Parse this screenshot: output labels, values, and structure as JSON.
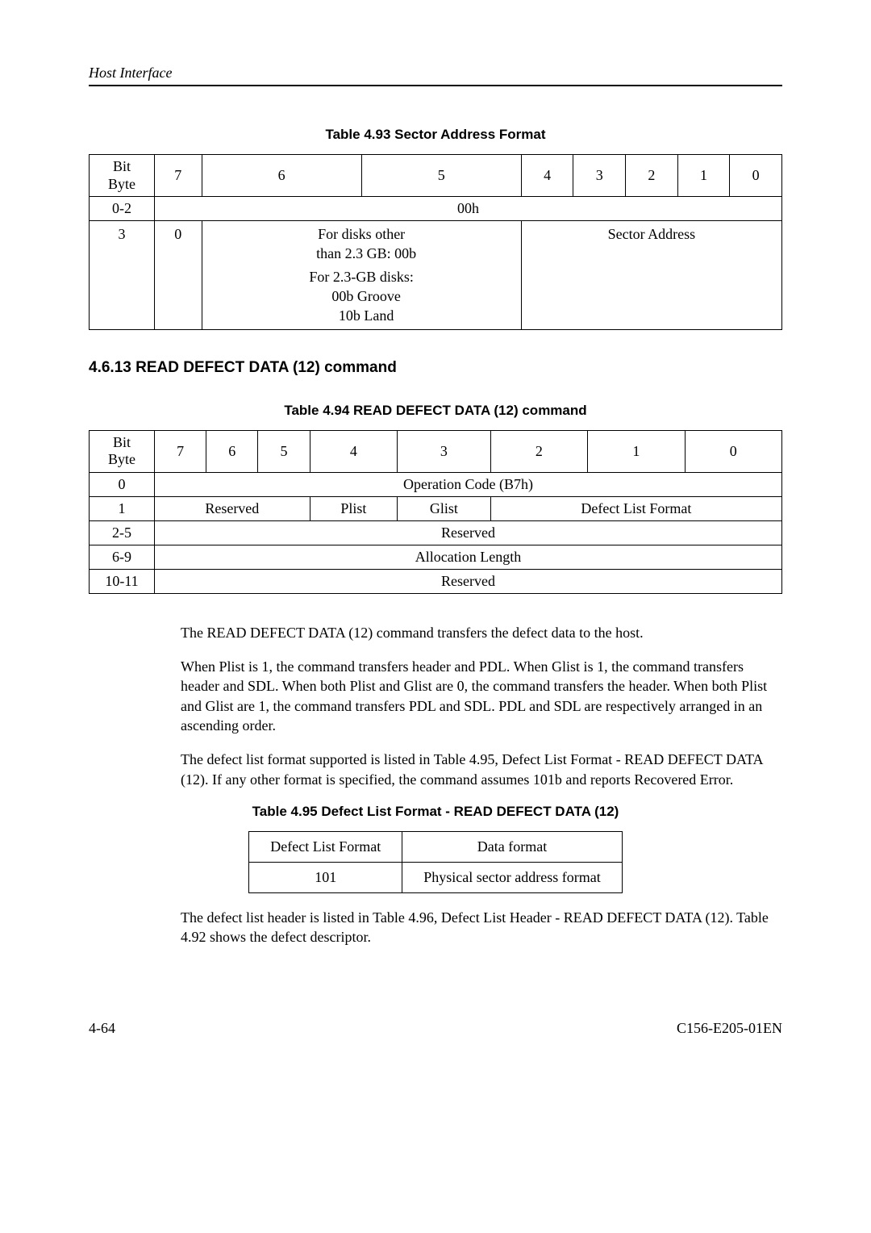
{
  "running_head": "Host Interface",
  "t93": {
    "caption": "Table 4.93  Sector Address Format",
    "bit": "Bit",
    "byte": "Byte",
    "cols": [
      "7",
      "6",
      "5",
      "4",
      "3",
      "2",
      "1",
      "0"
    ],
    "row1_label": "0-2",
    "row1_val": "00h",
    "row2_label": "3",
    "row2_c0": "0",
    "row2_notes_l1": "For disks other",
    "row2_notes_l2": "than 2.3 GB: 00b",
    "row2_notes_l3": "For 2.3-GB disks:",
    "row2_notes_l4": "00b  Groove",
    "row2_notes_l5": "10b  Land",
    "row2_sector": "Sector Address"
  },
  "sec_heading": "4.6.13  READ DEFECT DATA (12) command",
  "t94": {
    "caption": "Table 4.94  READ DEFECT DATA (12) command",
    "bit": "Bit",
    "byte": "Byte",
    "cols": [
      "7",
      "6",
      "5",
      "4",
      "3",
      "2",
      "1",
      "0"
    ],
    "r0_label": "0",
    "r0_val": "Operation Code (B7h)",
    "r1_label": "1",
    "r1_reserved": "Reserved",
    "r1_plist": "Plist",
    "r1_glist": "Glist",
    "r1_dlf": "Defect List Format",
    "r2_label": "2-5",
    "r2_val": "Reserved",
    "r3_label": "6-9",
    "r3_val": "Allocation Length",
    "r4_label": "10-11",
    "r4_val": "Reserved"
  },
  "para1": "The READ DEFECT DATA (12) command transfers the defect data to the host.",
  "para2": "When Plist is 1, the command transfers header and PDL.  When Glist is 1, the command transfers header and SDL.  When both Plist and Glist are 0, the command transfers the header.  When both Plist and Glist are 1, the command transfers PDL and SDL.  PDL and SDL are respectively arranged in an ascending order.",
  "para3": "The defect list format supported is listed in Table 4.95, Defect List Format - READ DEFECT DATA (12).  If any other format is specified, the command assumes 101b and reports Recovered Error.",
  "t95": {
    "caption": "Table 4.95  Defect List Format - READ DEFECT DATA (12)",
    "h1": "Defect List Format",
    "h2": "Data format",
    "c1": "101",
    "c2": "Physical sector address format"
  },
  "para4": "The defect list header is listed in Table 4.96, Defect List Header - READ DEFECT DATA (12).  Table 4.92 shows the defect descriptor.",
  "footer_left": "4-64",
  "footer_right": "C156-E205-01EN"
}
